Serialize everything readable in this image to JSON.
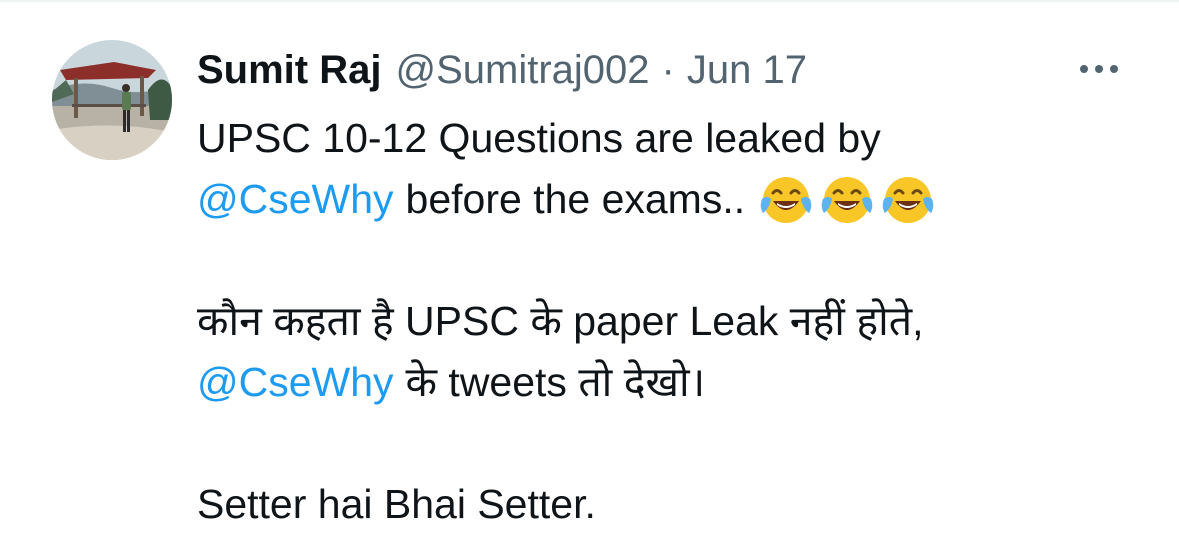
{
  "tweet": {
    "author": {
      "display_name": "Sumit Raj",
      "handle": "@Sumitraj002",
      "avatar_icon": "profile-photo"
    },
    "separator": "·",
    "date": "Jun 17",
    "more_icon": "more-horizontal-icon",
    "body": {
      "line1": "UPSC 10-12 Questions are leaked by",
      "line2_mention": "@CseWhy",
      "line2_text": "before the exams..",
      "line2_emojis": [
        "face-with-tears-of-joy",
        "face-with-tears-of-joy",
        "face-with-tears-of-joy"
      ],
      "line4": "कौन कहता है UPSC के paper Leak नहीं होते,",
      "line5_mention": "@CseWhy",
      "line5_text": "के tweets तो देखो।",
      "line7": "Setter hai Bhai Setter."
    }
  },
  "colors": {
    "text_primary": "#0f1419",
    "text_secondary": "#536471",
    "link": "#1d9bf0",
    "divider": "#eff3f4"
  }
}
